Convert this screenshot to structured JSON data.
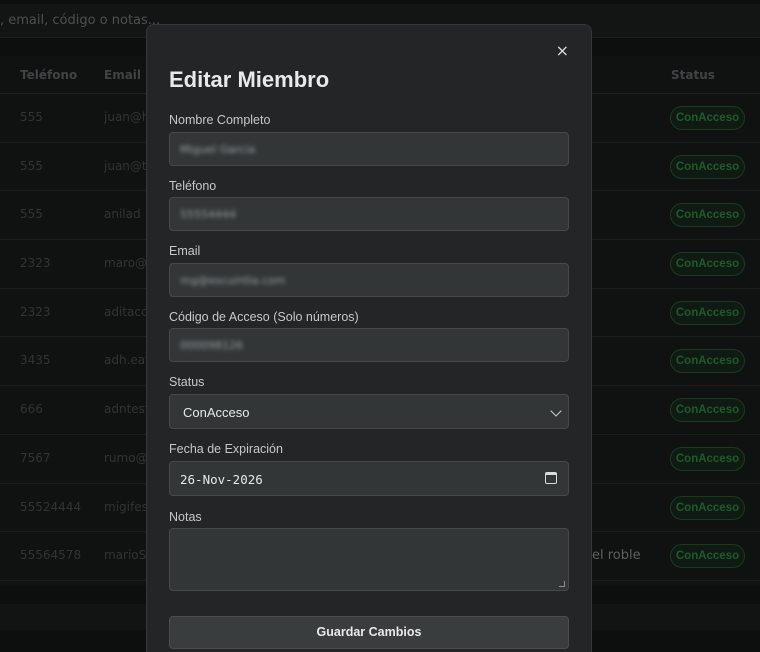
{
  "search": {
    "placeholder": ", email, código o notas..."
  },
  "table": {
    "headers": [
      "Teléfono",
      "Email",
      "Status"
    ],
    "rows": [
      {
        "phone": "555",
        "email": "juan@h",
        "status": "ConAcceso",
        "note": ""
      },
      {
        "phone": "555",
        "email": "juan@t",
        "status": "ConAcceso",
        "note": ""
      },
      {
        "phone": "555",
        "email": "anilad",
        "status": "ConAcceso",
        "note": ""
      },
      {
        "phone": "2323",
        "email": "maro@",
        "status": "ConAcceso",
        "note": ""
      },
      {
        "phone": "2323",
        "email": "aditacc",
        "status": "ConAcceso",
        "note": ""
      },
      {
        "phone": "3435",
        "email": "adh.eat",
        "status": "ConAcceso",
        "note": ""
      },
      {
        "phone": "666",
        "email": "adntest",
        "status": "ConAcceso",
        "note": ""
      },
      {
        "phone": "7567",
        "email": "rumo@",
        "status": "ConAcceso",
        "note": ""
      },
      {
        "phone": "55524444",
        "email": "migifes",
        "status": "ConAcceso",
        "note": ""
      },
      {
        "phone": "55564578",
        "email": "marioS4",
        "status": "ConAcceso",
        "note": "el roble"
      }
    ]
  },
  "modal": {
    "title": "Editar Miembro",
    "close_icon": "×",
    "fields": {
      "name": {
        "label": "Nombre Completo",
        "value": "Miguel Garcia"
      },
      "phone": {
        "label": "Teléfono",
        "value": "55554444"
      },
      "email": {
        "label": "Email",
        "value": "mg@escuintla.com"
      },
      "code": {
        "label": "Código de Acceso (Solo números)",
        "value": "000098126"
      },
      "status": {
        "label": "Status",
        "value": "ConAcceso"
      },
      "expiry": {
        "label": "Fecha de Expiración",
        "value": "26-Nov-2026"
      },
      "notes": {
        "label": "Notas",
        "value": ""
      }
    },
    "save_label": "Guardar Cambios"
  }
}
